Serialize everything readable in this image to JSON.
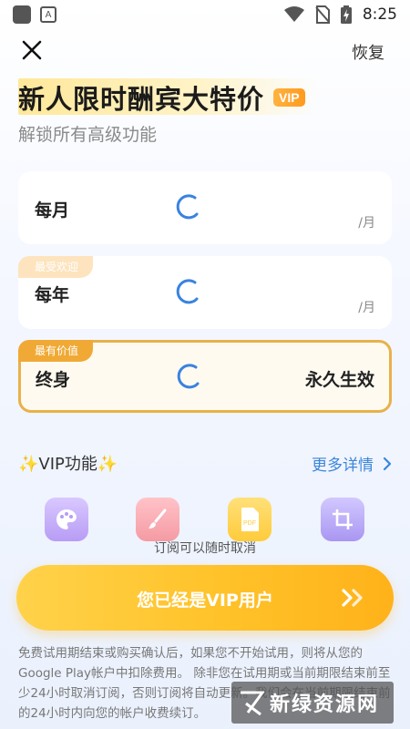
{
  "status_bar": {
    "time": "8:25",
    "notif_letter": "A"
  },
  "header": {
    "restore_label": "恢复"
  },
  "hero": {
    "title": "新人限时酬宾大特价",
    "vip_badge": "VIP",
    "subtitle": "解锁所有高级功能"
  },
  "plans": [
    {
      "name": "每月",
      "unit": "/月",
      "tag": "",
      "note": ""
    },
    {
      "name": "每年",
      "unit": "/月",
      "tag": "最受欢迎",
      "note": ""
    },
    {
      "name": "终身",
      "unit": "",
      "tag": "最有价值",
      "note": "永久生效",
      "selected": true
    }
  ],
  "features": {
    "title": "✨VIP功能✨",
    "more_label": "更多详情",
    "icons": [
      "palette-icon",
      "brush-icon",
      "pdf-icon",
      "crop-icon"
    ]
  },
  "cancel_note": "订阅可以随时取消",
  "cta": {
    "label": "您已经是VIP用户"
  },
  "disclaimer": "免费试用期结束或购买确认后，如果您不开始试用，则将从您的Google Play帐户中扣除费用。 除非您在试用期或当前期限结束前至少24小时取消订阅，否则订阅将自动更新。我们会在当前期限结束前的24小时内向您的帐户收费续订。",
  "watermark": {
    "text": "新绿资源网"
  },
  "colors": {
    "accent": "#ffc229",
    "link": "#3c86d9",
    "selected_border": "#e8b14a"
  }
}
